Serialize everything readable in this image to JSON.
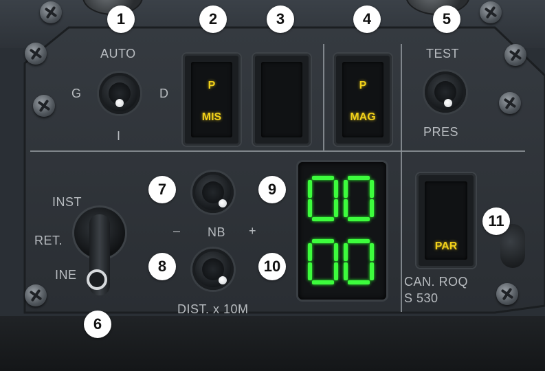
{
  "panel": {
    "labels": {
      "auto": "AUTO",
      "g": "G",
      "d": "D",
      "i": "I",
      "test": "TEST",
      "pres": "PRES",
      "inst": "INST",
      "ret": "RET.",
      "ine": "INE",
      "minus": "–",
      "nb": "NB",
      "plus": "+",
      "dist": "DIST. x 10M",
      "can_roq": "CAN. ROQ",
      "s530": "S 530"
    },
    "lamps": {
      "mis": {
        "top": "P",
        "bottom": "MIS"
      },
      "blank": {
        "top": "",
        "bottom": ""
      },
      "mag": {
        "top": "P",
        "bottom": "MAG"
      },
      "par": {
        "text": "PAR"
      }
    },
    "display": {
      "top_digits": "00",
      "bottom_digits": "00",
      "segment_color": "#3dfc3d"
    }
  },
  "callouts": [
    "1",
    "2",
    "3",
    "4",
    "5",
    "6",
    "7",
    "8",
    "9",
    "10",
    "11"
  ],
  "colors": {
    "panel_bg": "#2e3338",
    "lamp_text": "#f2d11a",
    "label_text": "#b8bcc0",
    "callout_bg": "#ffffff"
  }
}
